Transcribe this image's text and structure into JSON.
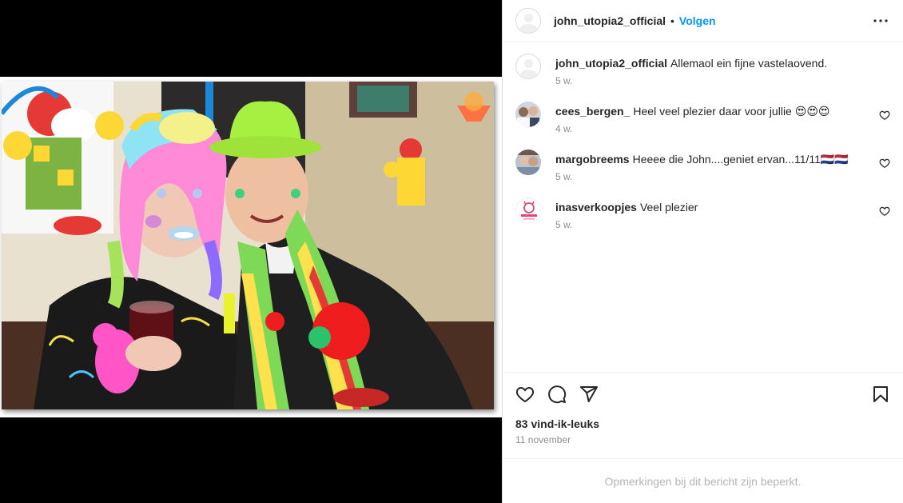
{
  "post": {
    "author": "john_utopia2_official",
    "follow_label": "Volgen",
    "dot": "•",
    "image_alt": "Carnaval foto: vrouw en man verkleed"
  },
  "comments": [
    {
      "username": "john_utopia2_official",
      "text": "Allemaol ein fijne vastelaovend.",
      "time": "5 w.",
      "avatar": "blank"
    },
    {
      "username": "cees_bergen_",
      "text": "Heel veel plezier daar voor jullie 😍😍😍",
      "time": "4 w.",
      "avatar": "photo-cees"
    },
    {
      "username": "margobreems",
      "text": "Heeee die John....geniet ervan...11/11🇳🇱🇳🇱",
      "time": "5 w.",
      "avatar": "photo-margo"
    },
    {
      "username": "inasverkoopjes",
      "text": "Veel plezier",
      "time": "5 w.",
      "avatar": "logo-inas"
    }
  ],
  "actions": {
    "icons": [
      "heart-icon",
      "comment-icon",
      "share-icon",
      "bookmark-icon"
    ]
  },
  "likes": "83 vind-ik-leuks",
  "date": "11 november",
  "restricted_notice": "Opmerkingen bij dit bericht zijn beperkt.",
  "colors": {
    "accent": "#0095f6",
    "text": "#262626",
    "muted": "#8e8e8e",
    "border": "#efefef"
  }
}
